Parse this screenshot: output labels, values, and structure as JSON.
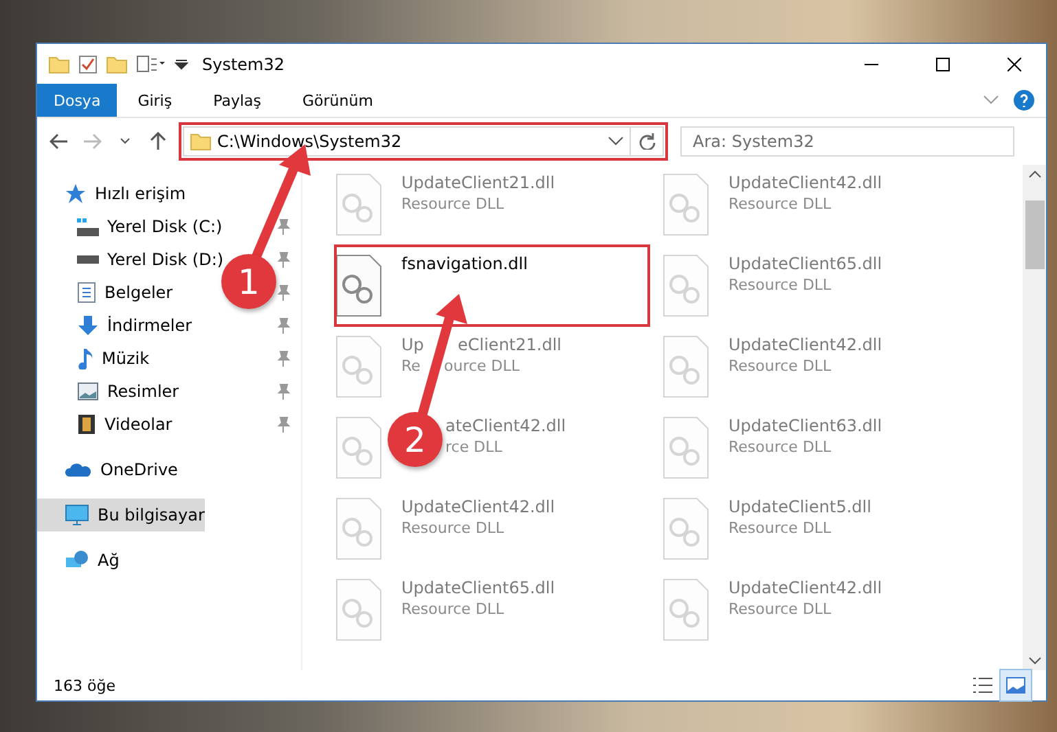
{
  "window": {
    "title": "System32"
  },
  "ribbon_tabs": [
    {
      "label": "Dosya",
      "selected": true
    },
    {
      "label": "Giriş",
      "selected": false
    },
    {
      "label": "Paylaş",
      "selected": false
    },
    {
      "label": "Görünüm",
      "selected": false
    }
  ],
  "address": {
    "path": "C:\\Windows\\System32"
  },
  "search": {
    "placeholder": "Ara: System32"
  },
  "sidebar": {
    "items": [
      {
        "label": "Hızlı erişim",
        "selected": false,
        "children": [
          {
            "label": "Yerel Disk (C:)",
            "pinned": true,
            "selected": false
          },
          {
            "label": "Yerel Disk (D:)",
            "pinned": true,
            "selected": false
          },
          {
            "label": "Belgeler",
            "pinned": true,
            "selected": false
          },
          {
            "label": "İndirmeler",
            "pinned": true,
            "selected": false
          },
          {
            "label": "Müzik",
            "pinned": true,
            "selected": false
          },
          {
            "label": "Resimler",
            "pinned": true,
            "selected": false
          },
          {
            "label": "Videolar",
            "pinned": true,
            "selected": false
          }
        ]
      },
      {
        "label": "OneDrive",
        "selected": false
      },
      {
        "label": "Bu bilgisayar",
        "selected": true
      },
      {
        "label": "Ağ",
        "selected": false
      }
    ]
  },
  "files": [
    {
      "kind": "plain",
      "name_parts": [
        "UpdateClient21.dll"
      ],
      "type_parts": [
        "Resource DLL"
      ],
      "faded": true
    },
    {
      "kind": "plain",
      "name_parts": [
        "UpdateClient42.dll"
      ],
      "type_parts": [
        "Resource DLL"
      ],
      "faded": true
    },
    {
      "kind": "plain",
      "name_parts": [
        "fsnavigation.dll"
      ],
      "faded": false
    },
    {
      "kind": "plain",
      "name_parts": [
        "UpdateClient65.dll"
      ],
      "type_parts": [
        "Resource DLL"
      ],
      "faded": true
    },
    {
      "kind": "under-arrow",
      "name_parts": [
        "Up",
        "eClient21.dll"
      ],
      "type_parts": [
        "Re",
        "ource DLL"
      ],
      "faded": true
    },
    {
      "kind": "plain",
      "name_parts": [
        "UpdateClient42.dll"
      ],
      "type_parts": [
        "Resource DLL"
      ],
      "faded": true
    },
    {
      "kind": "under-badge",
      "name_parts": [
        "ateClient42.dll"
      ],
      "type_parts": [
        "rce DLL"
      ],
      "faded": true
    },
    {
      "kind": "plain",
      "name_parts": [
        "UpdateClient63.dll"
      ],
      "type_parts": [
        "Resource DLL"
      ],
      "faded": true
    },
    {
      "kind": "plain",
      "name_parts": [
        "UpdateClient42.dll"
      ],
      "type_parts": [
        "Resource DLL"
      ],
      "faded": true
    },
    {
      "kind": "plain",
      "name_parts": [
        "UpdateClient5.dll"
      ],
      "type_parts": [
        "Resource DLL"
      ],
      "faded": true
    },
    {
      "kind": "plain",
      "name_parts": [
        "UpdateClient65.dll"
      ],
      "type_parts": [
        "Resource DLL"
      ],
      "faded": true
    },
    {
      "kind": "plain",
      "name_parts": [
        "UpdateClient42.dll"
      ],
      "type_parts": [
        "Resource DLL"
      ],
      "faded": true
    }
  ],
  "status_bar": {
    "count": "163 öğe"
  },
  "annotations": [
    {
      "number": "1"
    },
    {
      "number": "2"
    }
  ]
}
